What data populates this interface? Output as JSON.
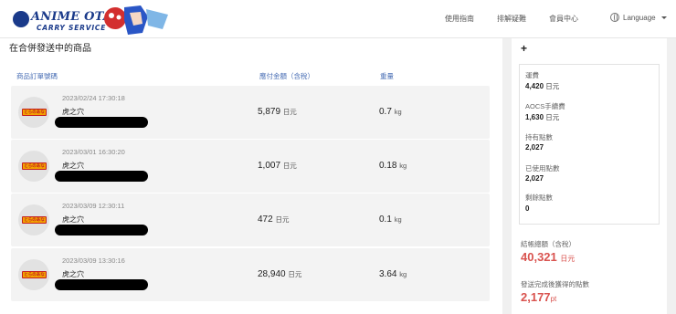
{
  "header": {
    "logo_title": "ANIME OTAKU",
    "logo_sub": "CARRY SERVICE",
    "nav": [
      "使用指南",
      "排解疑難",
      "會員中心"
    ],
    "language": "Language"
  },
  "main": {
    "title": "在合併發送中的商品",
    "columns": {
      "order": "商品訂單號碼",
      "amount": "應付金額（含稅）",
      "weight": "重量"
    },
    "currency_unit": "日元",
    "weight_unit": "kg",
    "rows": [
      {
        "date": "2023/02/24 17:30:18",
        "shop": "虎之穴",
        "amount": "5,879",
        "weight": "0.7"
      },
      {
        "date": "2023/03/01 16:30:20",
        "shop": "虎之穴",
        "amount": "1,007",
        "weight": "0.18"
      },
      {
        "date": "2023/03/09 12:30:11",
        "shop": "虎之穴",
        "amount": "472",
        "weight": "0.1"
      },
      {
        "date": "2023/03/09 13:30:16",
        "shop": "虎之穴",
        "amount": "28,940",
        "weight": "3.64"
      }
    ],
    "shop_tag": "とらのあな"
  },
  "sidebar": {
    "plus": "+",
    "shipping_label": "運費",
    "shipping_value": "4,420",
    "fee_label": "AOCS手續費",
    "fee_value": "1,630",
    "points_held_label": "持有點數",
    "points_held_value": "2,027",
    "points_used_label": "已使用點數",
    "points_used_value": "2,027",
    "points_left_label": "剩餘點數",
    "points_left_value": "0",
    "total_label": "結帳總額（含稅）",
    "total_value": "40,321",
    "earned_label": "發送完成後獲得的點數",
    "earned_value": "2,177",
    "earned_unit": "pt",
    "currency_unit": "日元"
  },
  "colors": {
    "accent_blue": "#4a6fb5",
    "total_red": "#d9534f"
  }
}
